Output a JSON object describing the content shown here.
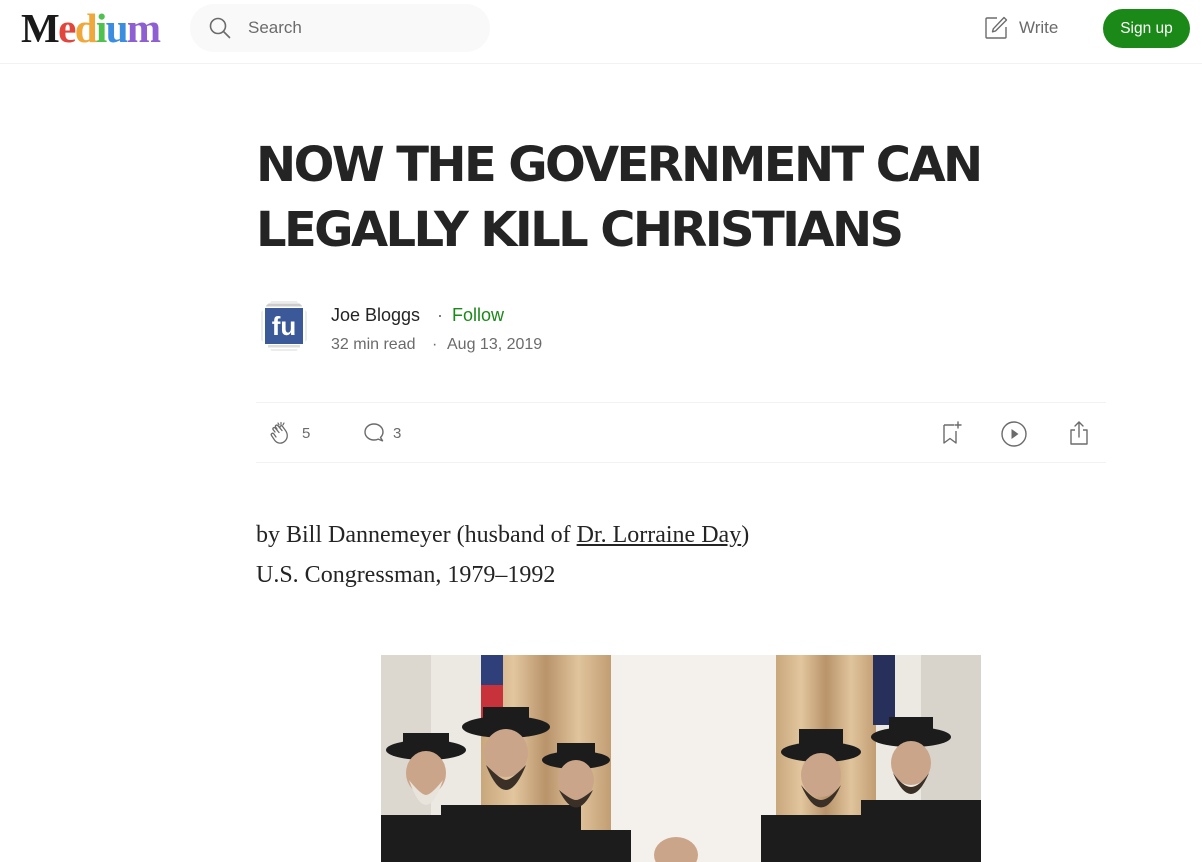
{
  "nav": {
    "logo_text": "Medium",
    "logo_colors": [
      "#1a1a1a",
      "#e2453c",
      "#f0a83a",
      "#4ec24e",
      "#3b8de0",
      "#8e5fd2"
    ],
    "search_placeholder": "Search",
    "write_label": "Write",
    "signup_label": "Sign up"
  },
  "article": {
    "title_line1": "NOW THE GOVERNMENT CAN",
    "title_line2": "LEGALLY KILL CHRISTIANS",
    "author": {
      "name": "Joe Bloggs",
      "separator": "·",
      "follow_label": "Follow",
      "avatar_text": "fu"
    },
    "read_time": "32 min read",
    "date": "Aug 13, 2019",
    "claps": "5",
    "responses": "3",
    "body": {
      "p1_prefix": "by Bill Dannemeyer (husband of ",
      "p1_link": "Dr. Lorraine Day",
      "p1_suffix": ")",
      "p2": "U.S. Congressman, 1979–1992"
    }
  },
  "icons": {
    "search": "search-icon",
    "write": "write-icon",
    "clap": "clap-icon",
    "response": "response-icon",
    "save": "bookmark-icon",
    "listen": "play-icon",
    "share": "share-icon"
  },
  "colors": {
    "accent_green": "#1a8917",
    "text_dark": "#242424",
    "text_muted": "#6b6b6b"
  }
}
